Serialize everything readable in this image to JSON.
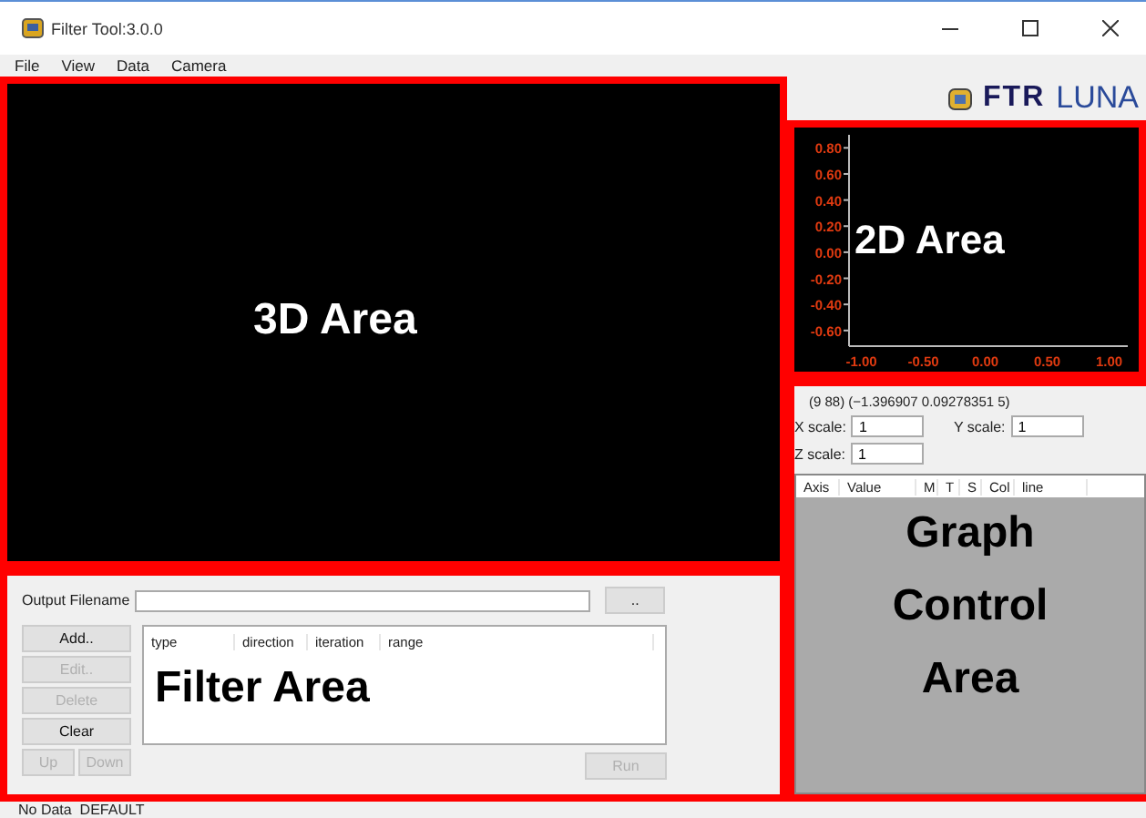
{
  "window": {
    "title": "Filter Tool:3.0.0"
  },
  "menu": [
    "File",
    "View",
    "Data",
    "Camera"
  ],
  "logo": {
    "brand": "FTR",
    "product": "LUNA"
  },
  "view_3d": {
    "label": "3D Area"
  },
  "view_2d": {
    "label": "2D Area",
    "chart_data": {
      "type": "line",
      "xlim": [
        -1.1,
        1.15
      ],
      "ylim": [
        -0.72,
        0.9
      ],
      "xticks": [
        {
          "value": -1,
          "label": "-1.00"
        },
        {
          "value": -0.5,
          "label": "-0.50"
        },
        {
          "value": 0,
          "label": "0.00"
        },
        {
          "value": 0.5,
          "label": "0.50"
        },
        {
          "value": 1,
          "label": "1.00"
        }
      ],
      "yticks": [
        {
          "value": 0.8,
          "label": "0.80"
        },
        {
          "value": 0.6,
          "label": "0.60"
        },
        {
          "value": 0.4,
          "label": "0.40"
        },
        {
          "value": 0.2,
          "label": "0.20"
        },
        {
          "value": 0,
          "label": "0.00"
        },
        {
          "value": -0.2,
          "label": "-0.20"
        },
        {
          "value": -0.4,
          "label": "-0.40"
        },
        {
          "value": -0.6,
          "label": "-0.60"
        }
      ]
    }
  },
  "filter": {
    "output_label": "Output Filename",
    "browse_button": "..",
    "buttons": [
      {
        "label": "Add..",
        "disabled": false
      },
      {
        "label": "Edit..",
        "disabled": true
      },
      {
        "label": "Delete",
        "disabled": true
      },
      {
        "label": "Clear",
        "disabled": false
      },
      {
        "label": "Up",
        "disabled": true
      },
      {
        "label": "Down",
        "disabled": true
      }
    ],
    "columns": [
      "type",
      "direction",
      "iteration",
      "range"
    ],
    "overlay": "Filter Area",
    "run_button": {
      "label": "Run",
      "disabled": true
    }
  },
  "graph_control": {
    "coordinates": "(9 88) (−1.396907 0.09278351 5)",
    "scales": [
      {
        "label": "X scale:",
        "value": "1"
      },
      {
        "label": "Y scale:",
        "value": "1"
      },
      {
        "label": "Z scale:",
        "value": "1"
      }
    ],
    "columns": [
      "Axis",
      "Value",
      "M",
      "T",
      "S",
      "Col",
      "line"
    ],
    "overlay": [
      "Graph",
      "Control",
      "Area"
    ]
  },
  "status_bar": {
    "text": "No Data  DEFAULT"
  }
}
